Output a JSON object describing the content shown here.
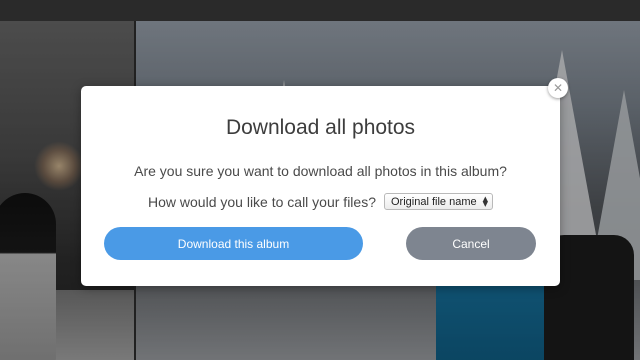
{
  "dialog": {
    "title": "Download all photos",
    "question": "Are you sure you want to download all photos in this album?",
    "naming_label": "How would you like to call your files?",
    "naming_select": {
      "selected": "Original file name"
    },
    "download_button": "Download this album",
    "cancel_button": "Cancel",
    "close_icon": "close-icon"
  },
  "colors": {
    "primary": "#4a9ae6",
    "secondary": "#7e8590"
  }
}
